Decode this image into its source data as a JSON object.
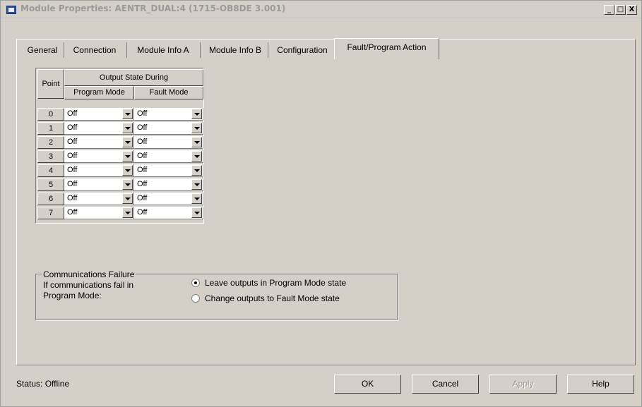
{
  "window": {
    "title": "Module Properties: AENTR_DUAL:4 (1715-OB8DE 3.001)",
    "controls": {
      "minimize": "_",
      "maximize": "□",
      "close": "X"
    }
  },
  "tabs": [
    {
      "label": "General"
    },
    {
      "label": "Connection"
    },
    {
      "label": "Module Info A"
    },
    {
      "label": "Module Info B"
    },
    {
      "label": "Configuration"
    },
    {
      "label": "Fault/Program Action",
      "active": true
    }
  ],
  "grid": {
    "point_header": "Point",
    "group_header": "Output State During",
    "program_mode_header": "Program Mode",
    "fault_mode_header": "Fault Mode",
    "rows": [
      {
        "point": "0",
        "program": "Off",
        "fault": "Off"
      },
      {
        "point": "1",
        "program": "Off",
        "fault": "Off"
      },
      {
        "point": "2",
        "program": "Off",
        "fault": "Off"
      },
      {
        "point": "3",
        "program": "Off",
        "fault": "Off"
      },
      {
        "point": "4",
        "program": "Off",
        "fault": "Off"
      },
      {
        "point": "5",
        "program": "Off",
        "fault": "Off"
      },
      {
        "point": "6",
        "program": "Off",
        "fault": "Off"
      },
      {
        "point": "7",
        "program": "Off",
        "fault": "Off"
      }
    ]
  },
  "comm_failure": {
    "title": "Communications Failure",
    "line1": "If communications fail in",
    "line2": "Program Mode:",
    "option_leave": "Leave outputs in Program Mode state",
    "option_change": "Change outputs to Fault Mode state",
    "selected": "leave"
  },
  "footer": {
    "status": "Status:  Offline",
    "ok": "OK",
    "cancel": "Cancel",
    "apply": "Apply",
    "help": "Help"
  }
}
